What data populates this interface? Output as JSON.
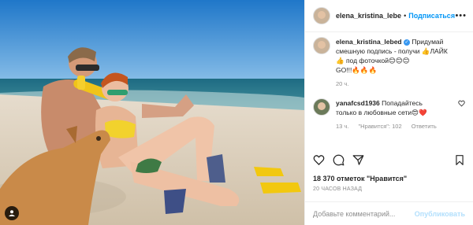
{
  "header": {
    "username": "elena_kristina_lebe",
    "separator": "•",
    "follow_label": "Подписаться",
    "more_icon": "•••"
  },
  "caption": {
    "username": "elena_kristina_lebed",
    "text_line1": "Придумай",
    "text_line2": "смешную подпись - получи 👍ЛАЙК",
    "text_line3": "👍 под фоточкой😊😊😊",
    "text_line4": "GO!!!🔥🔥🔥",
    "time": "20 ч."
  },
  "comment": {
    "username": "yanafcsd1936",
    "text_line1": "Попадайтесь",
    "text_line2": "только в любовные сети😍❤️",
    "time": "13 ч.",
    "likes": "\"Нравится\": 102",
    "reply": "Ответить"
  },
  "likes_text": "18 370 отметок \"Нравится\"",
  "time_ago": "20 ЧАСОВ НАЗАД",
  "add_comment": {
    "placeholder": "Добавьте комментарий...",
    "publish": "Опубликовать"
  }
}
